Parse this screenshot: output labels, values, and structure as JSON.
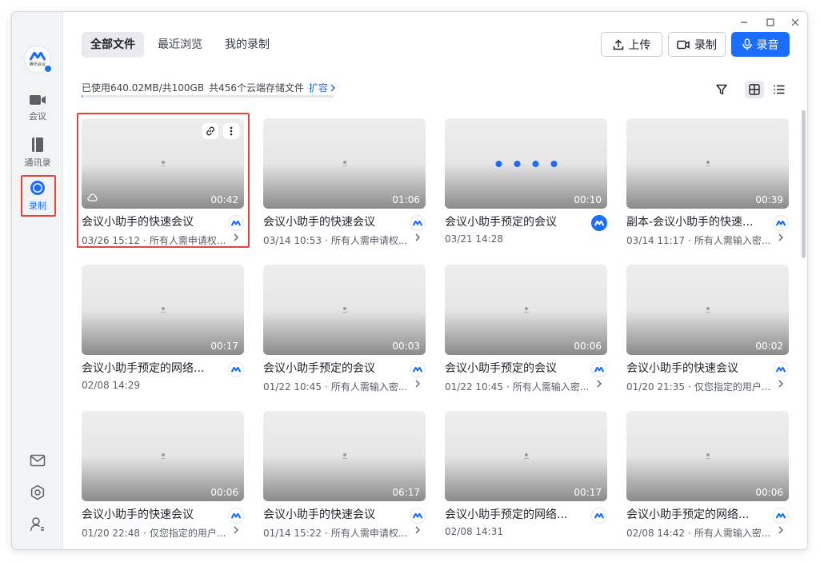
{
  "sidebar": {
    "logo_text": "腾讯会议",
    "items": [
      {
        "label": "会议",
        "icon": "video-camera-icon"
      },
      {
        "label": "通讯录",
        "icon": "contacts-book-icon"
      },
      {
        "label": "录制",
        "icon": "record-icon"
      }
    ],
    "bottom_icons": [
      "mail-icon",
      "settings-icon",
      "user-switch-icon"
    ]
  },
  "tabs": [
    {
      "label": "全部文件",
      "active": true
    },
    {
      "label": "最近浏览",
      "active": false
    },
    {
      "label": "我的录制",
      "active": false
    }
  ],
  "toolbar": {
    "upload_label": "上传",
    "record_label": "录制",
    "audio_label": "录音"
  },
  "storage": {
    "used_text": "已使用640.02MB/共100GB",
    "count_text": "共456个云端存储文件",
    "expand_label": "扩容"
  },
  "cards": [
    {
      "title": "会议小助手的快速会议",
      "date": "03/26 15:12",
      "meta": "所有人需申请权...",
      "duration": "00:42"
    },
    {
      "title": "会议小助手的快速会议",
      "date": "03/14 10:53",
      "meta": "所有人需申请权...",
      "duration": "01:06"
    },
    {
      "title": "会议小助手预定的会议",
      "date": "03/21 14:28",
      "meta": "",
      "duration": "00:10"
    },
    {
      "title": "副本-会议小助手的快速...",
      "date": "03/14 11:17",
      "meta": "所有人需输入密...",
      "duration": "00:39"
    },
    {
      "title": "会议小助手预定的网络...",
      "date": "02/08 14:29",
      "meta": "",
      "duration": "00:17"
    },
    {
      "title": "会议小助手预定的会议",
      "date": "01/22 10:45",
      "meta": "所有人需输入密...",
      "duration": "00:03"
    },
    {
      "title": "会议小助手预定的会议",
      "date": "01/22 10:45",
      "meta": "所有人需输入密...",
      "duration": "00:06"
    },
    {
      "title": "会议小助手的快速会议",
      "date": "01/20 21:35",
      "meta": "仅您指定的用户...",
      "duration": "00:02"
    },
    {
      "title": "会议小助手的快速会议",
      "date": "01/20 22:48",
      "meta": "仅您指定的用户...",
      "duration": "00:06"
    },
    {
      "title": "会议小助手的快速会议",
      "date": "01/14 15:22",
      "meta": "所有人需申请权...",
      "duration": "06:17"
    },
    {
      "title": "会议小助手预定的网络...",
      "date": "02/08 14:31",
      "meta": "",
      "duration": "00:17"
    },
    {
      "title": "会议小助手预定的网络...",
      "date": "02/08 14:42",
      "meta": "所有人需输入密...",
      "duration": "00:06"
    }
  ],
  "colors": {
    "accent": "#1a6dff",
    "highlight": "#e2463c"
  }
}
